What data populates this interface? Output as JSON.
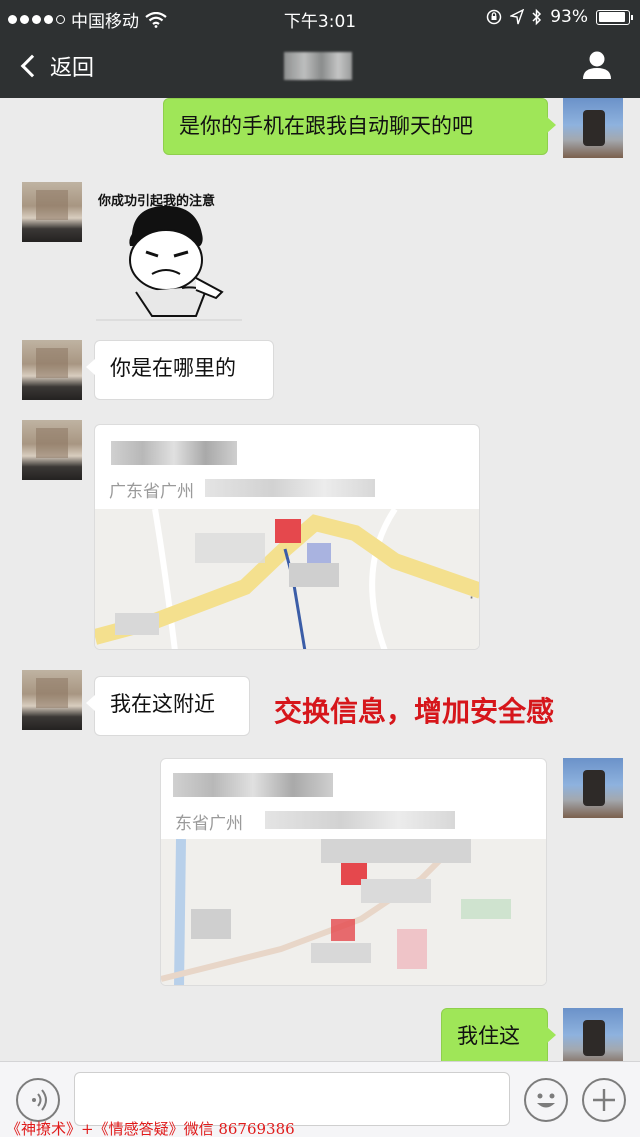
{
  "status_bar": {
    "carrier": "中国移动",
    "time": "下午3:01",
    "battery": "93%",
    "battery_level": 0.93,
    "icons": [
      "signal-dots",
      "wifi-icon",
      "lock-rotation-icon",
      "location-icon",
      "bluetooth-icon",
      "battery-icon"
    ]
  },
  "nav": {
    "back_label": "返回",
    "icons": [
      "back-chevron-icon",
      "profile-icon"
    ]
  },
  "messages": [
    {
      "side": "right",
      "type": "text",
      "text": "是你的手机在跟我自动聊天的吧"
    },
    {
      "side": "left",
      "type": "sticker",
      "caption": "你成功引起我的注意"
    },
    {
      "side": "left",
      "type": "text",
      "text": "你是在哪里的"
    },
    {
      "side": "left",
      "type": "location",
      "address_prefix": "广东省广州"
    },
    {
      "side": "left",
      "type": "text",
      "text": "我在这附近"
    },
    {
      "side": "right",
      "type": "location",
      "address_prefix": "东省广州"
    },
    {
      "side": "right",
      "type": "text",
      "text": "我住这"
    }
  ],
  "annotation": "交换信息，增加安全感",
  "watermark": "《神撩术》+《情感答疑》微信 86769386",
  "colors": {
    "nav_bg": "#2e3132",
    "chat_bg": "#ebebeb",
    "green_bubble": "#9fe658",
    "annotation_red": "#d6161b"
  }
}
